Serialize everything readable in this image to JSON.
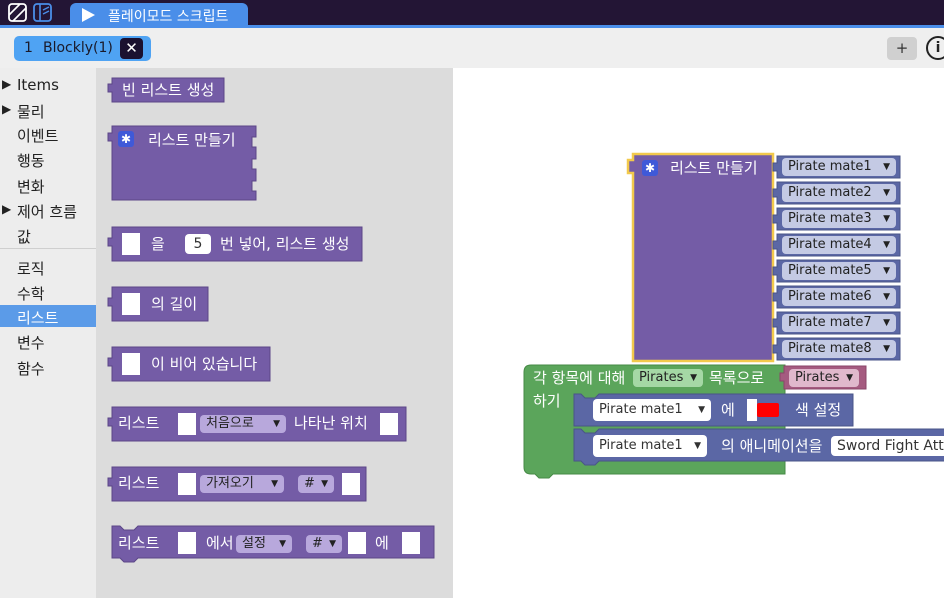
{
  "app": {
    "tab_title": "플레이모드 스크립트",
    "file_tab": {
      "index": "1",
      "label": "Blockly(1)"
    },
    "plus_label": "+",
    "info_label": "i"
  },
  "icons": {
    "left": "blockly-logo-icon",
    "right": "book-panel-icon",
    "tab": "play-icon",
    "close": "close-icon",
    "gear": "gear-icon"
  },
  "sidebar": {
    "items": [
      {
        "label": "Items",
        "arrow": "▶"
      },
      {
        "label": "물리",
        "arrow": "▶"
      },
      {
        "label": "이벤트",
        "arrow": ""
      },
      {
        "label": "행동",
        "arrow": ""
      },
      {
        "label": "변화",
        "arrow": ""
      },
      {
        "label": "제어 흐름",
        "arrow": "▶"
      },
      {
        "label": "값",
        "arrow": ""
      },
      {
        "label": "로직",
        "arrow": ""
      },
      {
        "label": "수학",
        "arrow": ""
      },
      {
        "label": "리스트",
        "arrow": ""
      },
      {
        "label": "변수",
        "arrow": ""
      },
      {
        "label": "함수",
        "arrow": ""
      }
    ],
    "selected": "리스트"
  },
  "flyout": {
    "empty_list": "빈 리스트 생성",
    "create_list": "리스트 만들기",
    "repeat_a": "을",
    "repeat_num": "5",
    "repeat_b": "번 넣어, 리스트 생성",
    "length": "의 길이",
    "is_empty": "이 비어 있습니다",
    "indexof_a": "리스트",
    "indexof_dd": "처음으로",
    "indexof_b": "나타난 위치",
    "get_a": "리스트",
    "get_dd": "가져오기",
    "get_idx": "#",
    "set_a": "리스트",
    "set_b": "에서",
    "set_dd": "설정",
    "set_idx": "#",
    "set_c": "에"
  },
  "workspace": {
    "make_list": {
      "label": "리스트 만들기",
      "items": [
        "Pirate mate1",
        "Pirate mate2",
        "Pirate mate3",
        "Pirate mate4",
        "Pirate mate5",
        "Pirate mate6",
        "Pirate mate7",
        "Pirate mate8"
      ]
    },
    "foreach": {
      "prefix": "각 항목에 대해",
      "var": "Pirates",
      "suffix": "목록으로",
      "list_var": "Pirates",
      "do": "하기"
    },
    "set_color": {
      "target": "Pirate mate1",
      "a": "에",
      "b": "색 설정",
      "color": "#ff0000"
    },
    "set_anim": {
      "target": "Pirate mate1",
      "a": "의 애니메이션을",
      "value": "Sword Fight Atta"
    }
  },
  "colors": {
    "list": "#745ca6",
    "list_stroke": "#5b4687",
    "control": "#5ba55b",
    "control_stroke": "#468a46",
    "item": "#5b67a5",
    "item_stroke": "#4a5488",
    "variable": "#a55b80",
    "selected": "#f2c94c"
  }
}
